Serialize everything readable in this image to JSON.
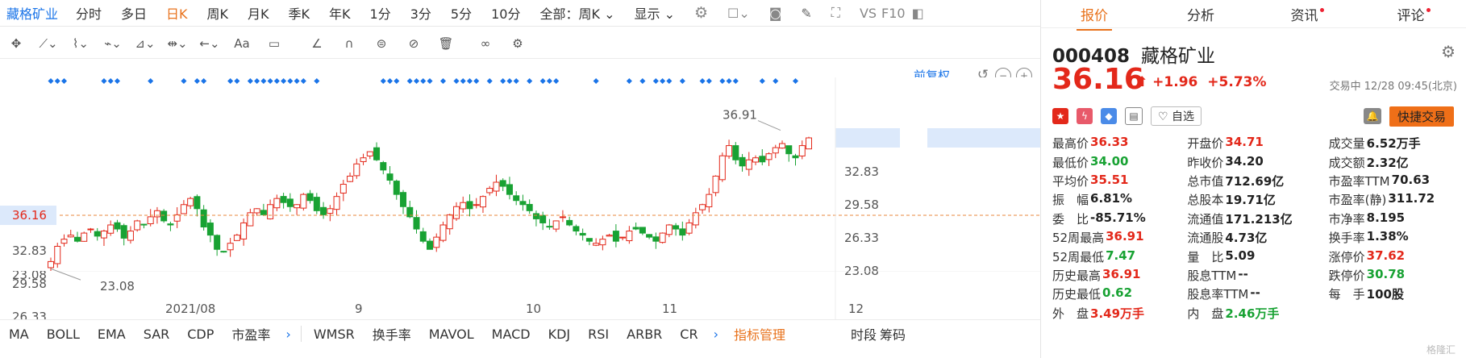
{
  "header": {
    "stock_name": "藏格矿业",
    "periods": [
      "分时",
      "多日",
      "日K",
      "周K",
      "月K",
      "季K",
      "年K",
      "1分",
      "3分",
      "5分",
      "10分"
    ],
    "selected_period": "日K",
    "range_select": "全部：周K",
    "display_label": "显示",
    "vs_label": "VS",
    "f10_label": "F10"
  },
  "chart_controls": {
    "adjust_label": "前复权"
  },
  "chart": {
    "price_labels": [
      "36.16",
      "32.83",
      "29.58",
      "26.33",
      "23.08"
    ],
    "current_price_label": "36.16",
    "high_annotation": "36.91",
    "low_annotation": "23.08",
    "date_labels": [
      "2021/08",
      "9",
      "10",
      "11",
      "12"
    ]
  },
  "chart_data": {
    "type": "candlestick",
    "ylim": [
      23.08,
      36.16
    ],
    "ticks": [
      "36.16",
      "32.83",
      "29.58",
      "26.33",
      "23.08"
    ],
    "x_tick_labels": [
      "2021/08",
      "9",
      "10",
      "11",
      "12"
    ],
    "reference_line": 36.16,
    "max_label": 36.91,
    "min_label": 23.08
  },
  "indicators": [
    "MA",
    "BOLL",
    "EMA",
    "SAR",
    "CDP",
    "市盈率",
    "WMSR",
    "换手率",
    "MAVOL",
    "MACD",
    "KDJ",
    "RSI",
    "ARBR",
    "CR"
  ],
  "indicator_manage": "指标管理",
  "bottom_right": [
    "时段",
    "筹码"
  ],
  "panel": {
    "tabs": [
      "报价",
      "分析",
      "资讯",
      "评论"
    ],
    "selected_tab": "报价",
    "code": "000408",
    "name": "藏格矿业",
    "price": "36.16",
    "arrow": "⬆",
    "change": "+1.96",
    "change_pct": "+5.73%",
    "status_time": "交易中 12/28 09:45(北京)",
    "watch_label": "自选",
    "quick_trade": "快捷交易",
    "stats": [
      [
        {
          "l": "最高价",
          "v": "36.33",
          "c": "red"
        },
        {
          "l": "开盘价",
          "v": "34.71",
          "c": "red"
        },
        {
          "l": "成交量",
          "v": "6.52万手",
          "c": "blk"
        }
      ],
      [
        {
          "l": "最低价",
          "v": "34.00",
          "c": "green"
        },
        {
          "l": "昨收价",
          "v": "34.20",
          "c": "blk"
        },
        {
          "l": "成交额",
          "v": "2.32亿",
          "c": "blk"
        }
      ],
      [
        {
          "l": "平均价",
          "v": "35.51",
          "c": "red"
        },
        {
          "l": "总市值",
          "v": "712.69亿",
          "c": "blk"
        },
        {
          "l": "市盈率TTM",
          "v": "70.63",
          "c": "blk"
        }
      ],
      [
        {
          "l": "振　幅",
          "v": "6.81%",
          "c": "blk"
        },
        {
          "l": "总股本",
          "v": "19.71亿",
          "c": "blk"
        },
        {
          "l": "市盈率(静)",
          "v": "311.72",
          "c": "blk"
        }
      ],
      [
        {
          "l": "委　比",
          "v": "-85.71%",
          "c": "blk"
        },
        {
          "l": "流通值",
          "v": "171.213亿",
          "c": "blk"
        },
        {
          "l": "市净率",
          "v": "8.195",
          "c": "blk"
        }
      ],
      [
        {
          "l": "52周最高",
          "v": "36.91",
          "c": "red"
        },
        {
          "l": "流通股",
          "v": "4.73亿",
          "c": "blk"
        },
        {
          "l": "换手率",
          "v": "1.38%",
          "c": "blk"
        }
      ],
      [
        {
          "l": "52周最低",
          "v": "7.47",
          "c": "green"
        },
        {
          "l": "量　比",
          "v": "5.09",
          "c": "blk"
        },
        {
          "l": "涨停价",
          "v": "37.62",
          "c": "red"
        }
      ],
      [
        {
          "l": "历史最高",
          "v": "36.91",
          "c": "red"
        },
        {
          "l": "股息TTM",
          "v": "--",
          "c": "blk"
        },
        {
          "l": "跌停价",
          "v": "30.78",
          "c": "green"
        }
      ],
      [
        {
          "l": "历史最低",
          "v": "0.62",
          "c": "green"
        },
        {
          "l": "股息率TTM",
          "v": "--",
          "c": "blk"
        },
        {
          "l": "每　手",
          "v": "100股",
          "c": "blk"
        }
      ],
      [
        {
          "l": "外　盘",
          "v": "3.49万手",
          "c": "red"
        },
        {
          "l": "内　盘",
          "v": "2.46万手",
          "c": "green"
        },
        {
          "l": "",
          "v": "",
          "c": "blk"
        }
      ]
    ],
    "watermark": "格隆汇"
  },
  "colors": {
    "up": "#e3281a",
    "down": "#18a233",
    "accent": "#e8721c",
    "link": "#1a74e8"
  }
}
